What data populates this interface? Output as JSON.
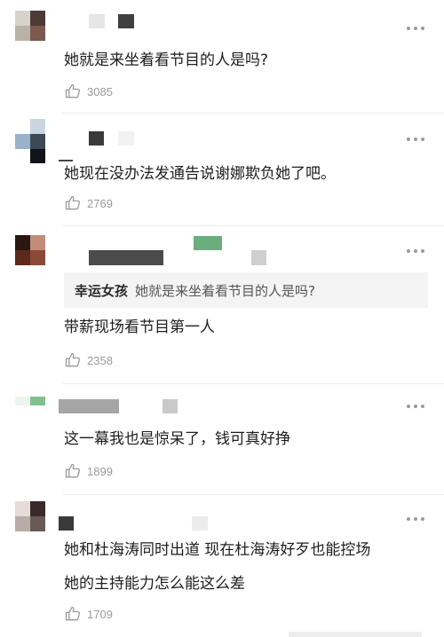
{
  "comments": [
    {
      "text_lines": [
        "她就是来坐着看节目的人是吗?"
      ],
      "likes": "3085",
      "avatar_colors": [
        "#d8d2cc",
        "#4c3a36",
        "#b9b2a6",
        "#7a5a4e"
      ]
    },
    {
      "text_lines": [
        "她现在没办法发通告说谢娜欺负她了吧。"
      ],
      "likes": "2769",
      "avatar_colors": [
        "#c9d6e2",
        "#9ab2c9",
        "#3c4a56",
        "#111418"
      ]
    },
    {
      "text_lines": [
        "带薪现场看节目第一人"
      ],
      "likes": "2358",
      "avatar_colors": [
        "#2a1612",
        "#c18d7a",
        "#5b2a1d",
        "#8a4a36"
      ],
      "quote": {
        "name": "幸运女孩",
        "text": "她就是来坐着看节目的人是吗?"
      }
    },
    {
      "text_lines": [
        "这一幕我也是惊呆了，钱可真好挣"
      ],
      "likes": "1899",
      "avatar_colors": [
        "#eef3ee",
        "#7fc08e",
        "#eef3ee",
        "#eef3ee"
      ]
    },
    {
      "text_lines": [
        "她和杜海涛同时出道 现在杜海涛好歹也能控场",
        "她的主持能力怎么能这么差"
      ],
      "likes": "1709",
      "avatar_colors": [
        "#e4dcd6",
        "#3a2a2a",
        "#b8aca6",
        "#6a5a56"
      ]
    }
  ],
  "colors": {
    "like_icon": "#9b9b9b",
    "more_dots": "#9a9a9a",
    "divider": "#ececec"
  },
  "icons": {
    "like": "thumbs-up-icon",
    "more": "more-horizontal-icon"
  }
}
